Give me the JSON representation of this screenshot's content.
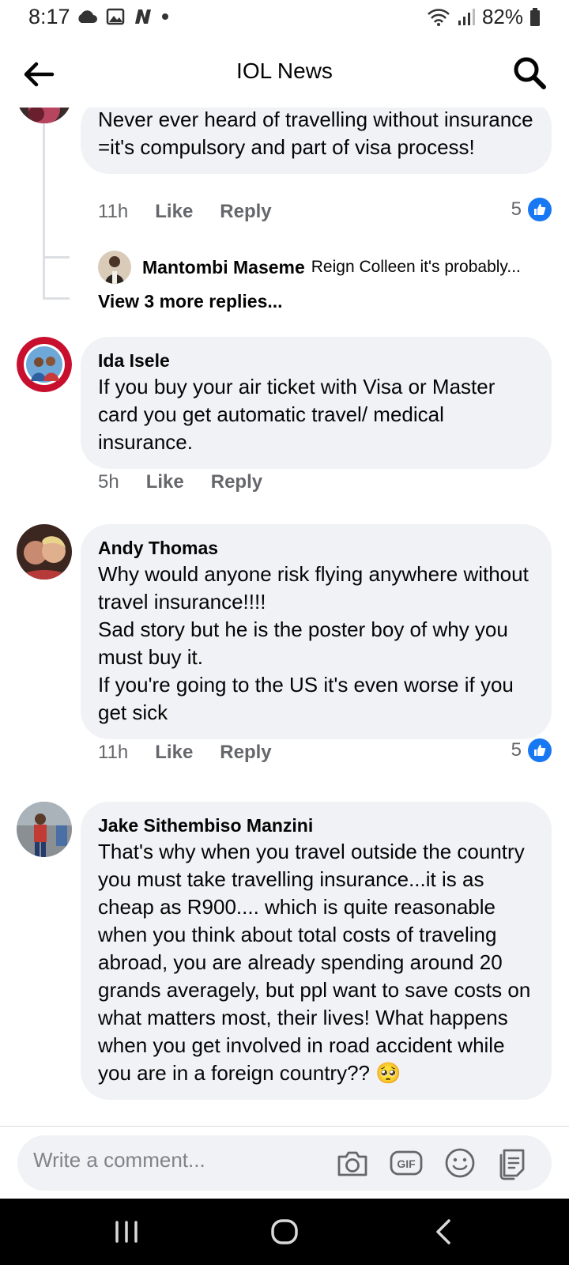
{
  "status": {
    "time": "8:17",
    "battery": "82%",
    "icons": [
      "cloud-icon",
      "gallery-icon",
      "n-app-icon",
      "dot-icon",
      "wifi-icon",
      "signal-icon",
      "battery-icon"
    ]
  },
  "header": {
    "title": "IOL News",
    "back_icon": "arrow-left-icon",
    "search_icon": "search-icon"
  },
  "comments": [
    {
      "name": "",
      "text": "Never ever heard of travelling without insurance =it's compulsory and part of visa process!",
      "time": "11h",
      "like_label": "Like",
      "reply_label": "Reply",
      "reactions": "5",
      "replies_preview": {
        "name": "Mantombi Maseme",
        "text": "Reign Colleen it's probably...",
        "more": "View 3 more replies..."
      }
    },
    {
      "name": "Ida Isele",
      "text": "If you buy your air ticket with Visa or Master card you get automatic travel/ medical insurance.",
      "time": "5h",
      "like_label": "Like",
      "reply_label": "Reply",
      "reactions": ""
    },
    {
      "name": "Andy Thomas",
      "text": "Why would anyone risk flying anywhere without travel insurance!!!!\nSad story but he is the poster boy of why you must buy it.\nIf you're going to the US it's even worse if you get sick",
      "time": "11h",
      "like_label": "Like",
      "reply_label": "Reply",
      "reactions": "5"
    },
    {
      "name": "Jake Sithembiso Manzini",
      "text": "That's why when you travel outside the country you must take travelling insurance...it is as cheap as R900.... which is quite reasonable when you think about total costs of traveling abroad, you are already spending around 20 grands averagely, but ppl want to save costs on what matters most, their lives! What happens when you get involved in road accident while you are in a foreign country?? 🥺",
      "time": "",
      "like_label": "",
      "reply_label": "",
      "reactions": ""
    }
  ],
  "composer": {
    "placeholder": "Write a comment...",
    "icons": [
      "camera-icon",
      "gif-icon",
      "emoji-icon",
      "sticker-icon"
    ]
  },
  "colors": {
    "bubble": "#f0f2f5",
    "like_blue": "#1877f2",
    "meta_gray": "#65676b"
  }
}
